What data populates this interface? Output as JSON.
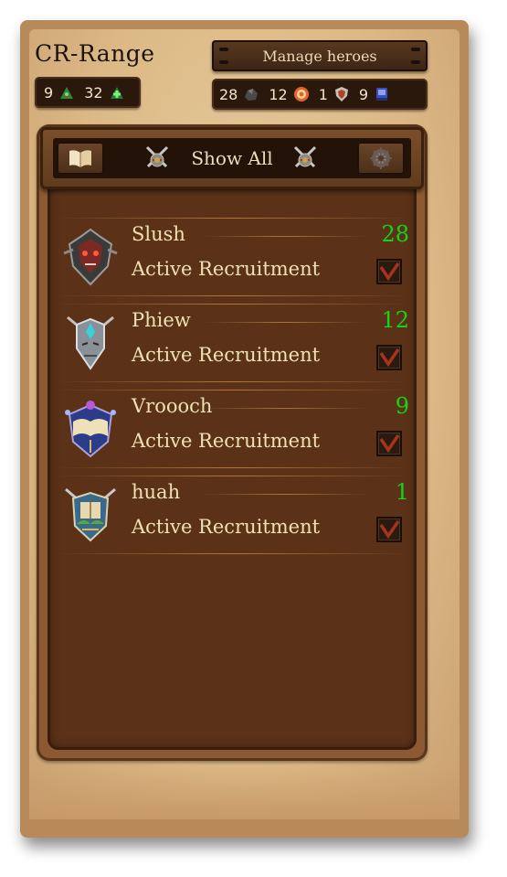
{
  "header": {
    "title": "CR-Range",
    "manage_label": "Manage heroes"
  },
  "resources_left": [
    {
      "value": "9",
      "icon": "green-arrows-icon"
    },
    {
      "value": "32",
      "icon": "green-plus-arrows-icon"
    }
  ],
  "resources_right": [
    {
      "value": "28",
      "icon": "ore-rock-icon"
    },
    {
      "value": "12",
      "icon": "target-icon"
    },
    {
      "value": "1",
      "icon": "shield-icon"
    },
    {
      "value": "9",
      "icon": "blue-tome-icon"
    }
  ],
  "toolbar": {
    "filter_label": "Show All",
    "left_button_icon": "open-book-icon",
    "right_button_icon": "gear-emblem-icon"
  },
  "colors": {
    "count_green": "#14d41a",
    "text_cream": "#f0e0b3",
    "check_red": "#a8331c"
  },
  "heroes": [
    {
      "name": "Slush",
      "count": "28",
      "status": "Active Recruitment",
      "checked": true,
      "crest": "demon-skull-crest-icon"
    },
    {
      "name": "Phiew",
      "count": "12",
      "status": "Active Recruitment",
      "checked": true,
      "crest": "silver-mask-crest-icon"
    },
    {
      "name": "Vroooch",
      "count": "9",
      "status": "Active Recruitment",
      "checked": true,
      "crest": "arcane-book-crest-icon"
    },
    {
      "name": "huah",
      "count": "1",
      "status": "Active Recruitment",
      "checked": true,
      "crest": "nature-tome-crest-icon"
    }
  ]
}
